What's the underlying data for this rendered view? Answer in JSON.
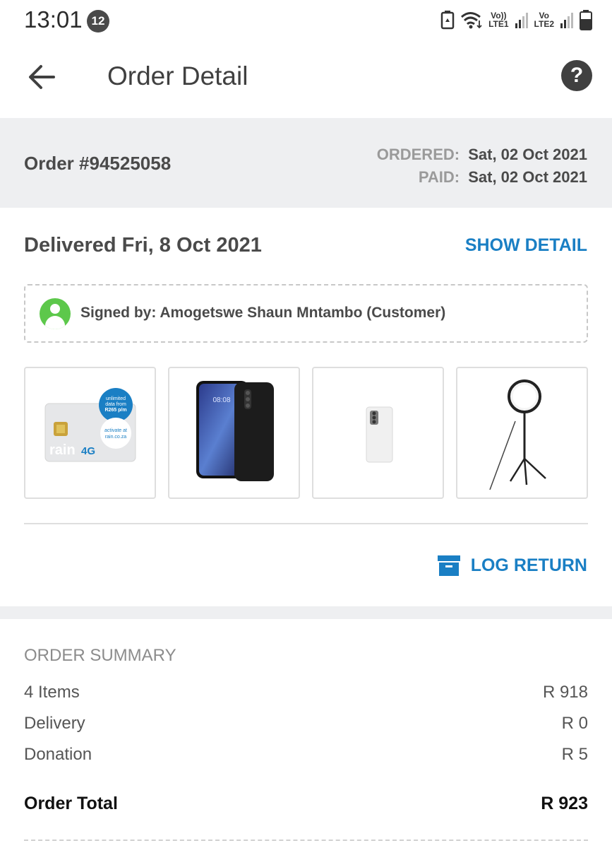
{
  "status_bar": {
    "time": "13:01",
    "notification_count": "12",
    "sim1_label_top": "Vo))",
    "sim1_label_bottom": "LTE1",
    "sim2_label_top": "Vo",
    "sim2_label_bottom": "LTE2"
  },
  "header": {
    "title": "Order Detail",
    "help_glyph": "?"
  },
  "order": {
    "number": "Order #94525058",
    "ordered_label": "ORDERED:",
    "ordered_date": "Sat, 02 Oct 2021",
    "paid_label": "PAID:",
    "paid_date": "Sat, 02 Oct 2021"
  },
  "delivery": {
    "status": "Delivered Fri, 8 Oct 2021",
    "show_detail": "SHOW DETAIL",
    "signed_by": "Signed by: Amogetswe Shaun Mntambo (Customer)"
  },
  "products": [
    {
      "name": "rain 4G SIM card",
      "brand": "rain",
      "brand_suffix": "4G",
      "badge_line1": "unlimited",
      "badge_line2": "data from",
      "badge_line3": "R265 p/m",
      "activate_line1": "activate at",
      "activate_line2": "rain.co.za"
    },
    {
      "name": "phone with black case",
      "screen_time": "08:08"
    },
    {
      "name": "white phone cover"
    },
    {
      "name": "ring light on tripod"
    }
  ],
  "actions": {
    "log_return": "LOG RETURN"
  },
  "summary": {
    "title": "ORDER SUMMARY",
    "rows": [
      {
        "label": "4 Items",
        "amount": "R 918"
      },
      {
        "label": "Delivery",
        "amount": "R 0"
      },
      {
        "label": "Donation",
        "amount": "R 5"
      }
    ],
    "total_label": "Order Total",
    "total_amount": "R 923"
  },
  "colors": {
    "accent": "#1a7fc4",
    "success": "#5dc84b",
    "band": "#eeeff1"
  }
}
